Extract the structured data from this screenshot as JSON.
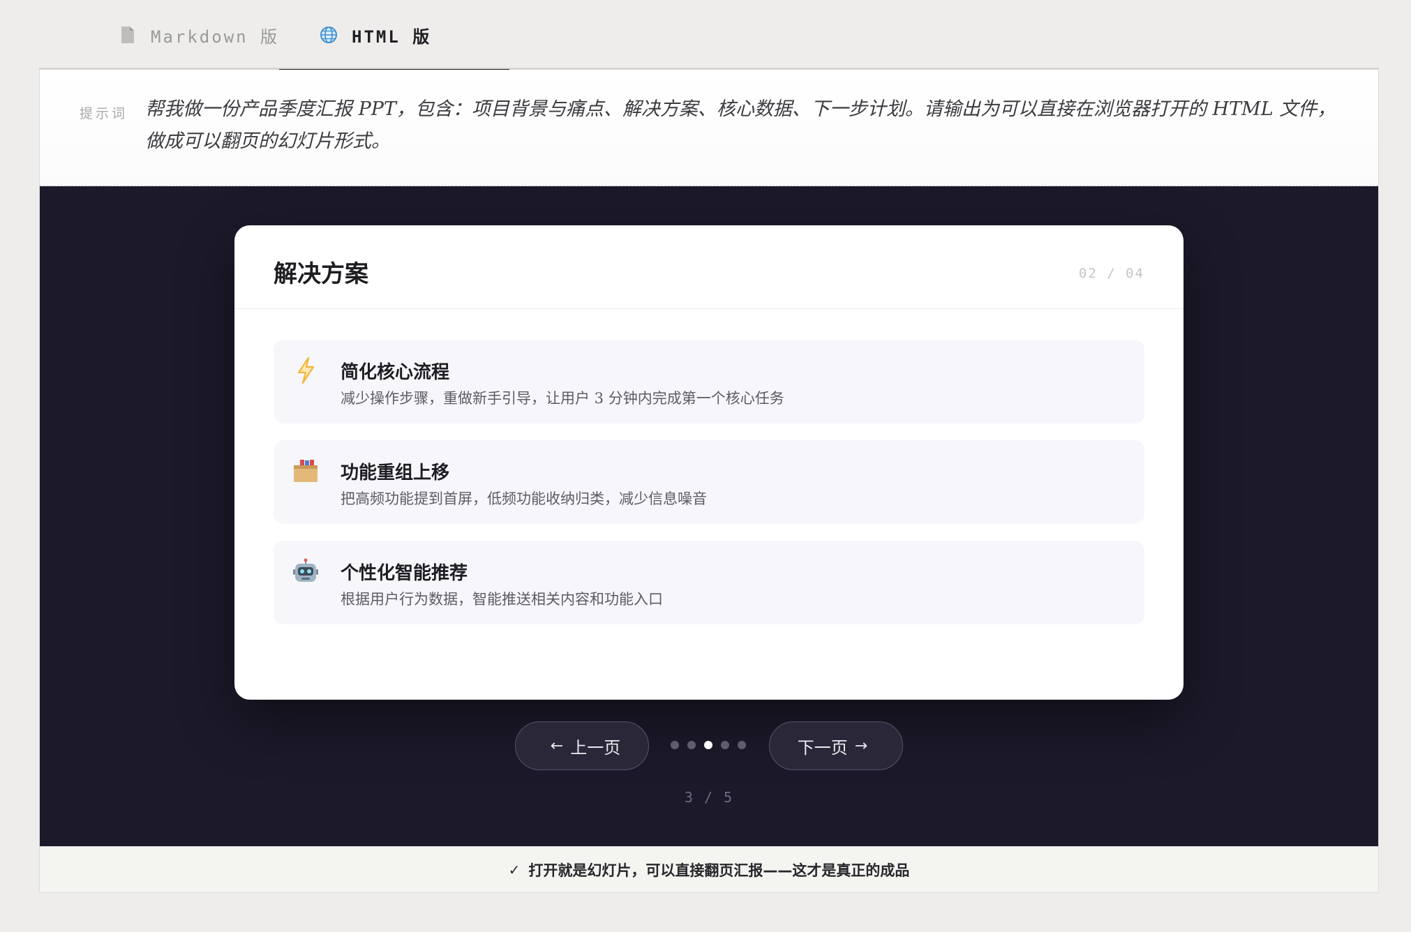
{
  "tabs": [
    {
      "label": "Markdown 版",
      "icon": "document-icon",
      "active": false
    },
    {
      "label": "HTML 版",
      "icon": "globe-icon",
      "active": true
    }
  ],
  "prompt": {
    "label": "提示词",
    "text": "帮我做一份产品季度汇报 PPT，包含：项目背景与痛点、解决方案、核心数据、下一步计划。请输出为可以直接在浏览器打开的 HTML 文件，做成可以翻页的幻灯片形式。"
  },
  "slide": {
    "title": "解决方案",
    "page": "02 / 04",
    "items": [
      {
        "icon": "lightning-icon",
        "title": "简化核心流程",
        "desc": "减少操作步骤，重做新手引导，让用户 3 分钟内完成第一个核心任务"
      },
      {
        "icon": "box-icon",
        "title": "功能重组上移",
        "desc": "把高频功能提到首屏，低频功能收纳归类，减少信息噪音"
      },
      {
        "icon": "robot-icon",
        "title": "个性化智能推荐",
        "desc": "根据用户行为数据，智能推送相关内容和功能入口"
      }
    ]
  },
  "nav": {
    "prev_label": "上一页",
    "next_label": "下一页",
    "prev_arrow": "←",
    "next_arrow": "→",
    "dots_total": 5,
    "dots_active": 3,
    "counter": "3 / 5"
  },
  "footer": {
    "check": "✓",
    "text": "打开就是幻灯片，可以直接翻页汇报——这才是真正的成品"
  },
  "colors": {
    "stage_bg": "#1c1a2a",
    "accent": "#f0b63a"
  }
}
